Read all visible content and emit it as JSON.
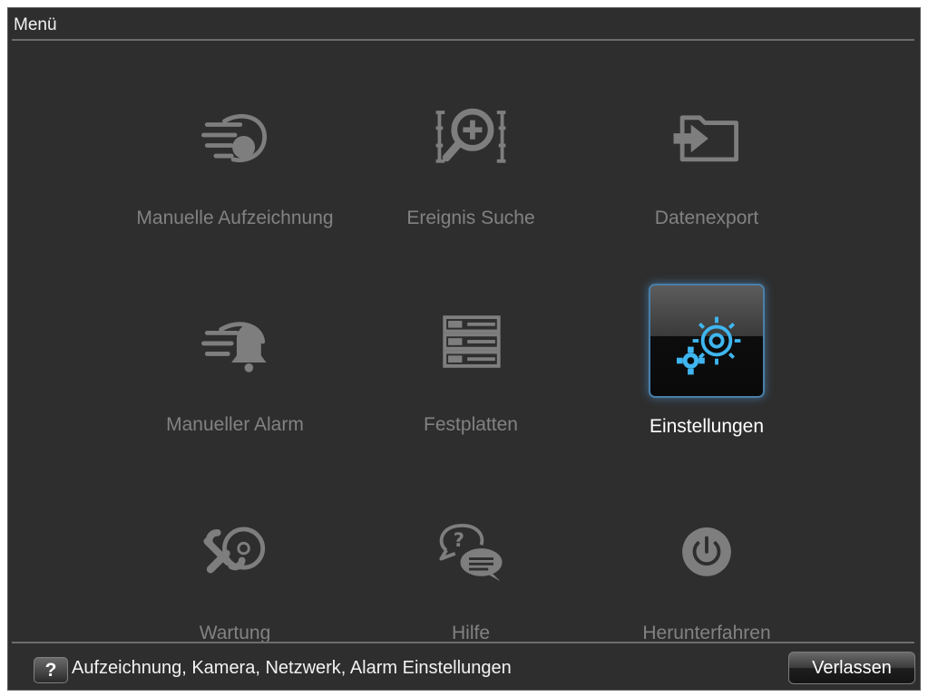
{
  "window": {
    "title": "Menü"
  },
  "menu": {
    "items": [
      {
        "label": "Manuelle Aufzeichnung",
        "icon": "manual-record-icon"
      },
      {
        "label": "Ereignis Suche",
        "icon": "event-search-icon"
      },
      {
        "label": "Datenexport",
        "icon": "data-export-icon"
      },
      {
        "label": "Manueller Alarm",
        "icon": "manual-alarm-icon"
      },
      {
        "label": "Festplatten",
        "icon": "hdd-icon"
      },
      {
        "label": "Einstellungen",
        "icon": "gear-icon",
        "selected": true
      },
      {
        "label": "Wartung",
        "icon": "maintenance-icon"
      },
      {
        "label": "Hilfe",
        "icon": "help-chat-icon"
      },
      {
        "label": "Herunterfahren",
        "icon": "power-icon"
      }
    ]
  },
  "footer": {
    "help_glyph": "?",
    "help_text": "Aufzeichnung, Kamera, Netzwerk, Alarm Einstellungen",
    "exit_label": "Verlassen"
  },
  "colors": {
    "background": "#2e2e2e",
    "inactive_text": "#828282",
    "active_text": "#ffffff",
    "icon_gray": "#7e7e7e",
    "accent_blue": "#3fb6f0"
  }
}
